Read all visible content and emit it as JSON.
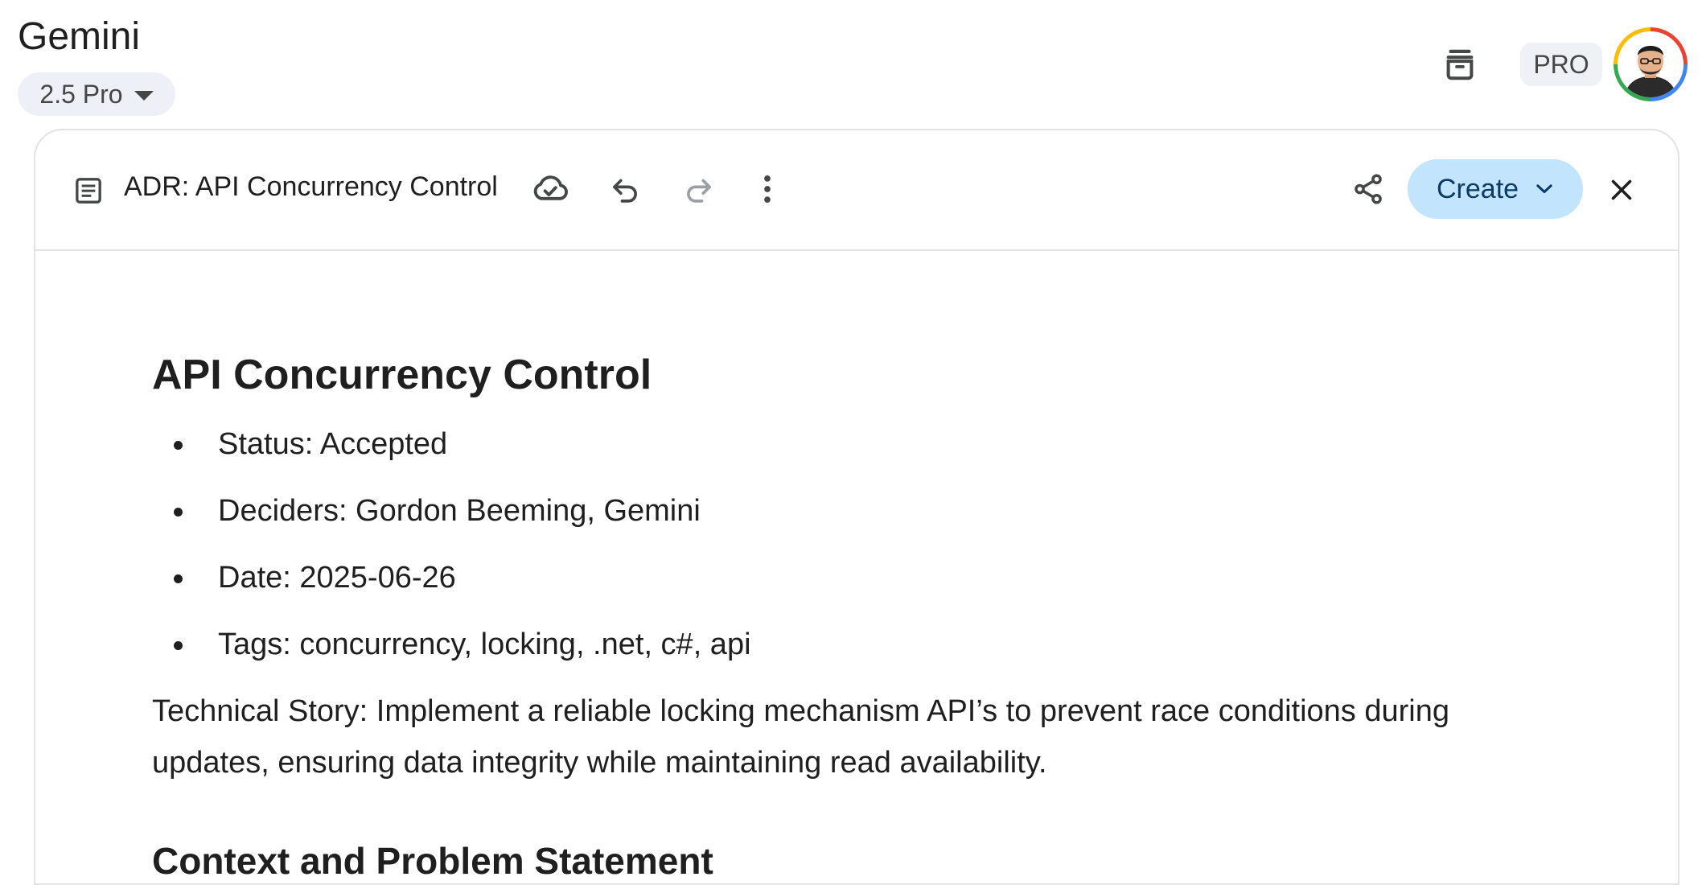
{
  "header": {
    "app_title": "Gemini",
    "model_label": "2.5 Pro",
    "pro_badge": "PRO"
  },
  "document": {
    "title": "ADR: API Concurrency Control",
    "create_label": "Create",
    "heading": "API Concurrency Control",
    "meta": [
      "Status: Accepted",
      "Deciders: Gordon Beeming, Gemini",
      "Date: 2025-06-26",
      "Tags: concurrency, locking, .net, c#, api"
    ],
    "technical_story": "Technical Story: Implement a reliable locking mechanism API’s to prevent race conditions during updates, ensuring data integrity while maintaining read availability.",
    "section_heading": "Context and Problem Statement"
  },
  "icons": {
    "header": [
      "archive-icon",
      "avatar"
    ],
    "toolbar": [
      "document-icon",
      "cloud-saved-icon",
      "undo-icon",
      "redo-icon",
      "more-vert-icon",
      "share-icon",
      "chevron-down-icon",
      "close-icon"
    ]
  },
  "colors": {
    "create_bg": "#c2e4fc",
    "create_text": "#0b3a66",
    "chip_bg": "#edf0f6",
    "border": "#e3e3e3"
  }
}
